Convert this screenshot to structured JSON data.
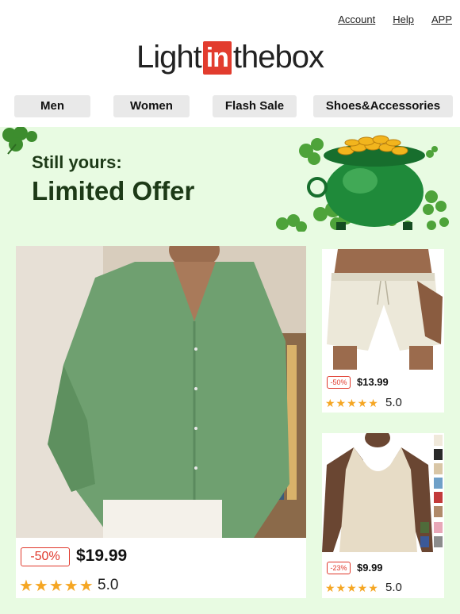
{
  "header": {
    "links": [
      "Account",
      "Help",
      "APP"
    ],
    "logo": {
      "pre": "Light",
      "box": "in",
      "post": "thebox"
    }
  },
  "nav": {
    "items": [
      "Men",
      "Women",
      "Flash Sale",
      "Shoes&Accessories"
    ]
  },
  "promo": {
    "subtitle": "Still yours:",
    "title": "Limited Offer"
  },
  "products": [
    {
      "name": "green linen shirt",
      "discount": "-50%",
      "price": "$19.99",
      "rating": "5.0",
      "stars": "★★★★★"
    },
    {
      "name": "white shorts",
      "discount": "-50%",
      "price": "$13.99",
      "rating": "5.0",
      "stars": "★★★★★"
    },
    {
      "name": "beige tank top",
      "discount": "-23%",
      "price": "$9.99",
      "rating": "5.0",
      "stars": "★★★★★"
    }
  ],
  "colors": {
    "brand_red": "#e23c2e",
    "promo_bg": "#e8fbe2",
    "title_green": "#1d3a17",
    "star_gold": "#f5a623"
  }
}
